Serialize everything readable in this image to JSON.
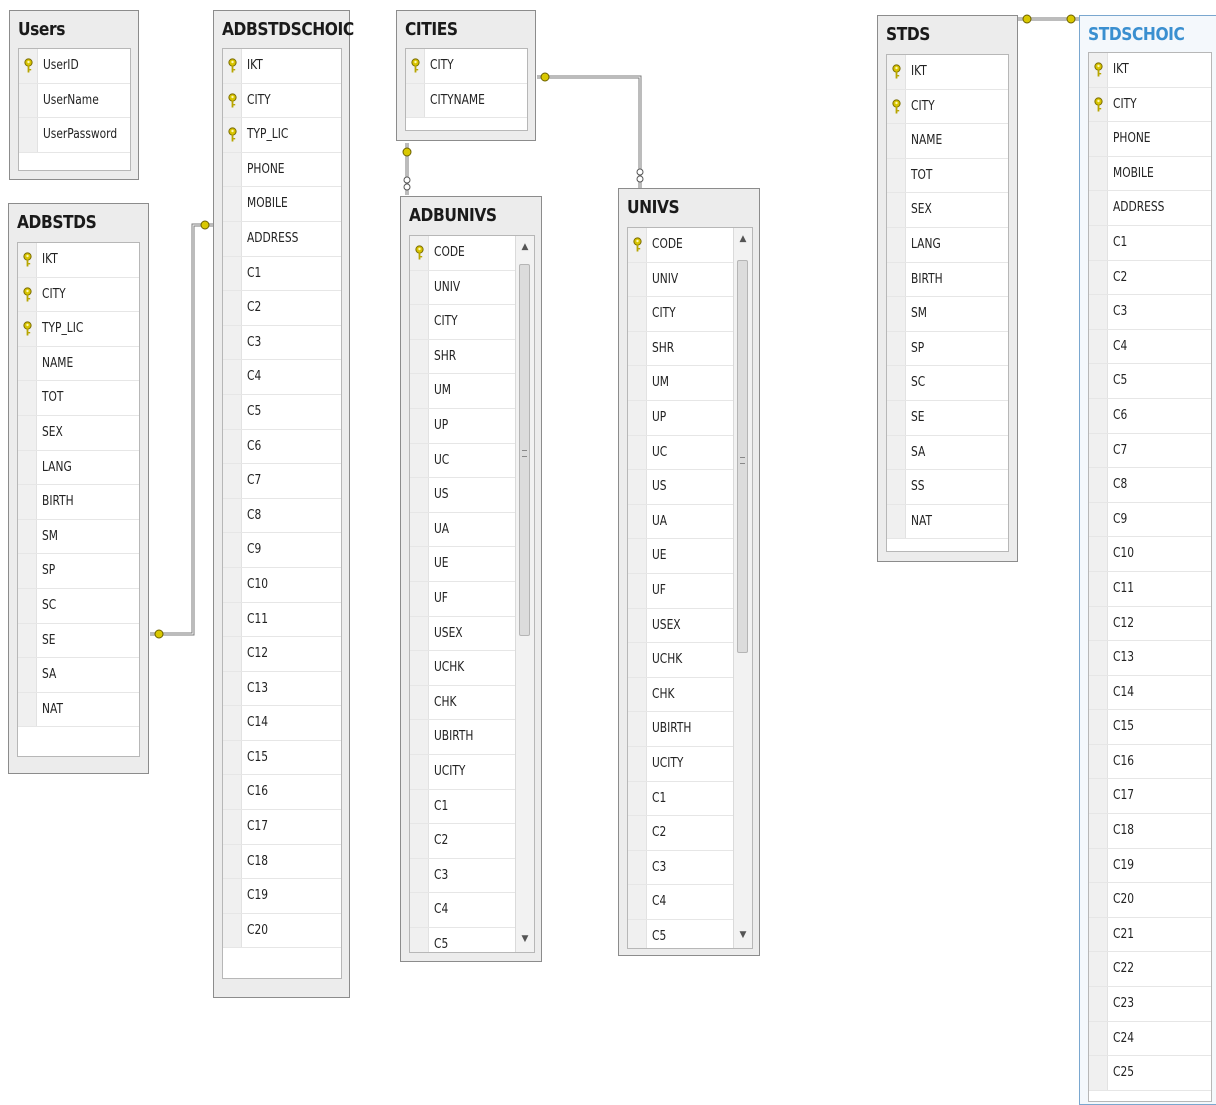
{
  "tables": [
    {
      "id": "users",
      "title": "Users",
      "columns": [
        {
          "name": "UserID",
          "pk": true
        },
        {
          "name": "UserName",
          "pk": false
        },
        {
          "name": "UserPassword",
          "pk": false
        }
      ]
    },
    {
      "id": "adbstds",
      "title": "ADBSTDS",
      "columns": [
        {
          "name": "IKT",
          "pk": true
        },
        {
          "name": "CITY",
          "pk": true
        },
        {
          "name": "TYP_LIC",
          "pk": true
        },
        {
          "name": "NAME",
          "pk": false
        },
        {
          "name": "TOT",
          "pk": false
        },
        {
          "name": "SEX",
          "pk": false
        },
        {
          "name": "LANG",
          "pk": false
        },
        {
          "name": "BIRTH",
          "pk": false
        },
        {
          "name": "SM",
          "pk": false
        },
        {
          "name": "SP",
          "pk": false
        },
        {
          "name": "SC",
          "pk": false
        },
        {
          "name": "SE",
          "pk": false
        },
        {
          "name": "SA",
          "pk": false
        },
        {
          "name": "NAT",
          "pk": false
        }
      ]
    },
    {
      "id": "adbstdschoic",
      "title": "ADBSTDSCHOIC",
      "columns": [
        {
          "name": "IKT",
          "pk": true
        },
        {
          "name": "CITY",
          "pk": true
        },
        {
          "name": "TYP_LIC",
          "pk": true
        },
        {
          "name": "PHONE",
          "pk": false
        },
        {
          "name": "MOBILE",
          "pk": false
        },
        {
          "name": "ADDRESS",
          "pk": false
        },
        {
          "name": "C1",
          "pk": false
        },
        {
          "name": "C2",
          "pk": false
        },
        {
          "name": "C3",
          "pk": false
        },
        {
          "name": "C4",
          "pk": false
        },
        {
          "name": "C5",
          "pk": false
        },
        {
          "name": "C6",
          "pk": false
        },
        {
          "name": "C7",
          "pk": false
        },
        {
          "name": "C8",
          "pk": false
        },
        {
          "name": "C9",
          "pk": false
        },
        {
          "name": "C10",
          "pk": false
        },
        {
          "name": "C11",
          "pk": false
        },
        {
          "name": "C12",
          "pk": false
        },
        {
          "name": "C13",
          "pk": false
        },
        {
          "name": "C14",
          "pk": false
        },
        {
          "name": "C15",
          "pk": false
        },
        {
          "name": "C16",
          "pk": false
        },
        {
          "name": "C17",
          "pk": false
        },
        {
          "name": "C18",
          "pk": false
        },
        {
          "name": "C19",
          "pk": false
        },
        {
          "name": "C20",
          "pk": false
        }
      ]
    },
    {
      "id": "cities",
      "title": "CITIES",
      "columns": [
        {
          "name": "CITY",
          "pk": true
        },
        {
          "name": "CITYNAME",
          "pk": false
        }
      ]
    },
    {
      "id": "adbunivs",
      "title": "ADBUNIVS",
      "columns": [
        {
          "name": "CODE",
          "pk": true
        },
        {
          "name": "UNIV",
          "pk": false
        },
        {
          "name": "CITY",
          "pk": false
        },
        {
          "name": "SHR",
          "pk": false
        },
        {
          "name": "UM",
          "pk": false
        },
        {
          "name": "UP",
          "pk": false
        },
        {
          "name": "UC",
          "pk": false
        },
        {
          "name": "US",
          "pk": false
        },
        {
          "name": "UA",
          "pk": false
        },
        {
          "name": "UE",
          "pk": false
        },
        {
          "name": "UF",
          "pk": false
        },
        {
          "name": "USEX",
          "pk": false
        },
        {
          "name": "UCHK",
          "pk": false
        },
        {
          "name": "CHK",
          "pk": false
        },
        {
          "name": "UBIRTH",
          "pk": false
        },
        {
          "name": "UCITY",
          "pk": false
        },
        {
          "name": "C1",
          "pk": false
        },
        {
          "name": "C2",
          "pk": false
        },
        {
          "name": "C3",
          "pk": false
        },
        {
          "name": "C4",
          "pk": false
        },
        {
          "name": "C5",
          "pk": false
        }
      ]
    },
    {
      "id": "univs",
      "title": "UNIVS",
      "columns": [
        {
          "name": "CODE",
          "pk": true
        },
        {
          "name": "UNIV",
          "pk": false
        },
        {
          "name": "CITY",
          "pk": false
        },
        {
          "name": "SHR",
          "pk": false
        },
        {
          "name": "UM",
          "pk": false
        },
        {
          "name": "UP",
          "pk": false
        },
        {
          "name": "UC",
          "pk": false
        },
        {
          "name": "US",
          "pk": false
        },
        {
          "name": "UA",
          "pk": false
        },
        {
          "name": "UE",
          "pk": false
        },
        {
          "name": "UF",
          "pk": false
        },
        {
          "name": "USEX",
          "pk": false
        },
        {
          "name": "UCHK",
          "pk": false
        },
        {
          "name": "CHK",
          "pk": false
        },
        {
          "name": "UBIRTH",
          "pk": false
        },
        {
          "name": "UCITY",
          "pk": false
        },
        {
          "name": "C1",
          "pk": false
        },
        {
          "name": "C2",
          "pk": false
        },
        {
          "name": "C3",
          "pk": false
        },
        {
          "name": "C4",
          "pk": false
        },
        {
          "name": "C5",
          "pk": false
        }
      ]
    },
    {
      "id": "stds",
      "title": "STDS",
      "columns": [
        {
          "name": "IKT",
          "pk": true
        },
        {
          "name": "CITY",
          "pk": true
        },
        {
          "name": "NAME",
          "pk": false
        },
        {
          "name": "TOT",
          "pk": false
        },
        {
          "name": "SEX",
          "pk": false
        },
        {
          "name": "LANG",
          "pk": false
        },
        {
          "name": "BIRTH",
          "pk": false
        },
        {
          "name": "SM",
          "pk": false
        },
        {
          "name": "SP",
          "pk": false
        },
        {
          "name": "SC",
          "pk": false
        },
        {
          "name": "SE",
          "pk": false
        },
        {
          "name": "SA",
          "pk": false
        },
        {
          "name": "SS",
          "pk": false
        },
        {
          "name": "NAT",
          "pk": false
        }
      ]
    },
    {
      "id": "stdschoic",
      "title": "STDSCHOIC",
      "selected": true,
      "columns": [
        {
          "name": "IKT",
          "pk": true
        },
        {
          "name": "CITY",
          "pk": true
        },
        {
          "name": "PHONE",
          "pk": false
        },
        {
          "name": "MOBILE",
          "pk": false
        },
        {
          "name": "ADDRESS",
          "pk": false
        },
        {
          "name": "C1",
          "pk": false
        },
        {
          "name": "C2",
          "pk": false
        },
        {
          "name": "C3",
          "pk": false
        },
        {
          "name": "C4",
          "pk": false
        },
        {
          "name": "C5",
          "pk": false
        },
        {
          "name": "C6",
          "pk": false
        },
        {
          "name": "C7",
          "pk": false
        },
        {
          "name": "C8",
          "pk": false
        },
        {
          "name": "C9",
          "pk": false
        },
        {
          "name": "C10",
          "pk": false
        },
        {
          "name": "C11",
          "pk": false
        },
        {
          "name": "C12",
          "pk": false
        },
        {
          "name": "C13",
          "pk": false
        },
        {
          "name": "C14",
          "pk": false
        },
        {
          "name": "C15",
          "pk": false
        },
        {
          "name": "C16",
          "pk": false
        },
        {
          "name": "C17",
          "pk": false
        },
        {
          "name": "C18",
          "pk": false
        },
        {
          "name": "C19",
          "pk": false
        },
        {
          "name": "C20",
          "pk": false
        },
        {
          "name": "C21",
          "pk": false
        },
        {
          "name": "C22",
          "pk": false
        },
        {
          "name": "C23",
          "pk": false
        },
        {
          "name": "C24",
          "pk": false
        },
        {
          "name": "C25",
          "pk": false
        }
      ]
    }
  ],
  "relationships": [
    {
      "from": "adbstds",
      "to": "adbstdschoic"
    },
    {
      "from": "cities",
      "to": "adbunivs"
    },
    {
      "from": "cities",
      "to": "univs"
    },
    {
      "from": "stds",
      "to": "stdschoic"
    }
  ],
  "colors": {
    "key_icon": "#c8b400",
    "selected_title": "#3a8fd0",
    "connector": "#7a7a7a"
  }
}
